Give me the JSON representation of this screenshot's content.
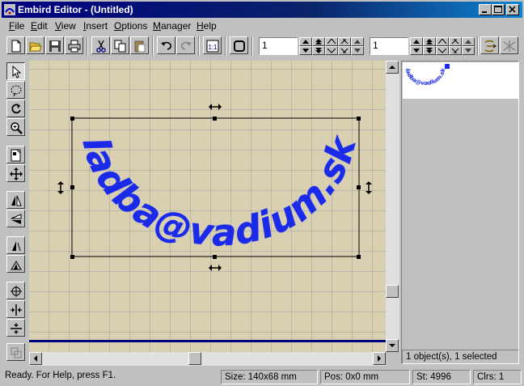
{
  "window": {
    "title": "Embird Editor - (Untitled)",
    "controls": [
      "minimize",
      "maximize",
      "close"
    ]
  },
  "menubar": {
    "items": [
      {
        "label": "File",
        "accel": "F"
      },
      {
        "label": "Edit",
        "accel": "E"
      },
      {
        "label": "View",
        "accel": "V"
      },
      {
        "label": "Insert",
        "accel": "I"
      },
      {
        "label": "Options",
        "accel": "O"
      },
      {
        "label": "Manager",
        "accel": "M"
      },
      {
        "label": "Help",
        "accel": "H"
      }
    ]
  },
  "toolbar": {
    "field1_value": "1",
    "field2_value": "1",
    "scale_label": "1:1"
  },
  "canvas": {
    "design_text": "ladba@vadium.sk",
    "design_color": "#1a2ae8"
  },
  "right_panel": {
    "thumbnail_text": "ladba@vadium.sk",
    "status": "1 object(s), 1 selected"
  },
  "statusbar": {
    "message": "Ready. For Help, press F1.",
    "size": "Size: 140x68 mm",
    "pos": "Pos: 0x0 mm",
    "stitches": "St: 4996",
    "colors": "Clrs: 1"
  }
}
